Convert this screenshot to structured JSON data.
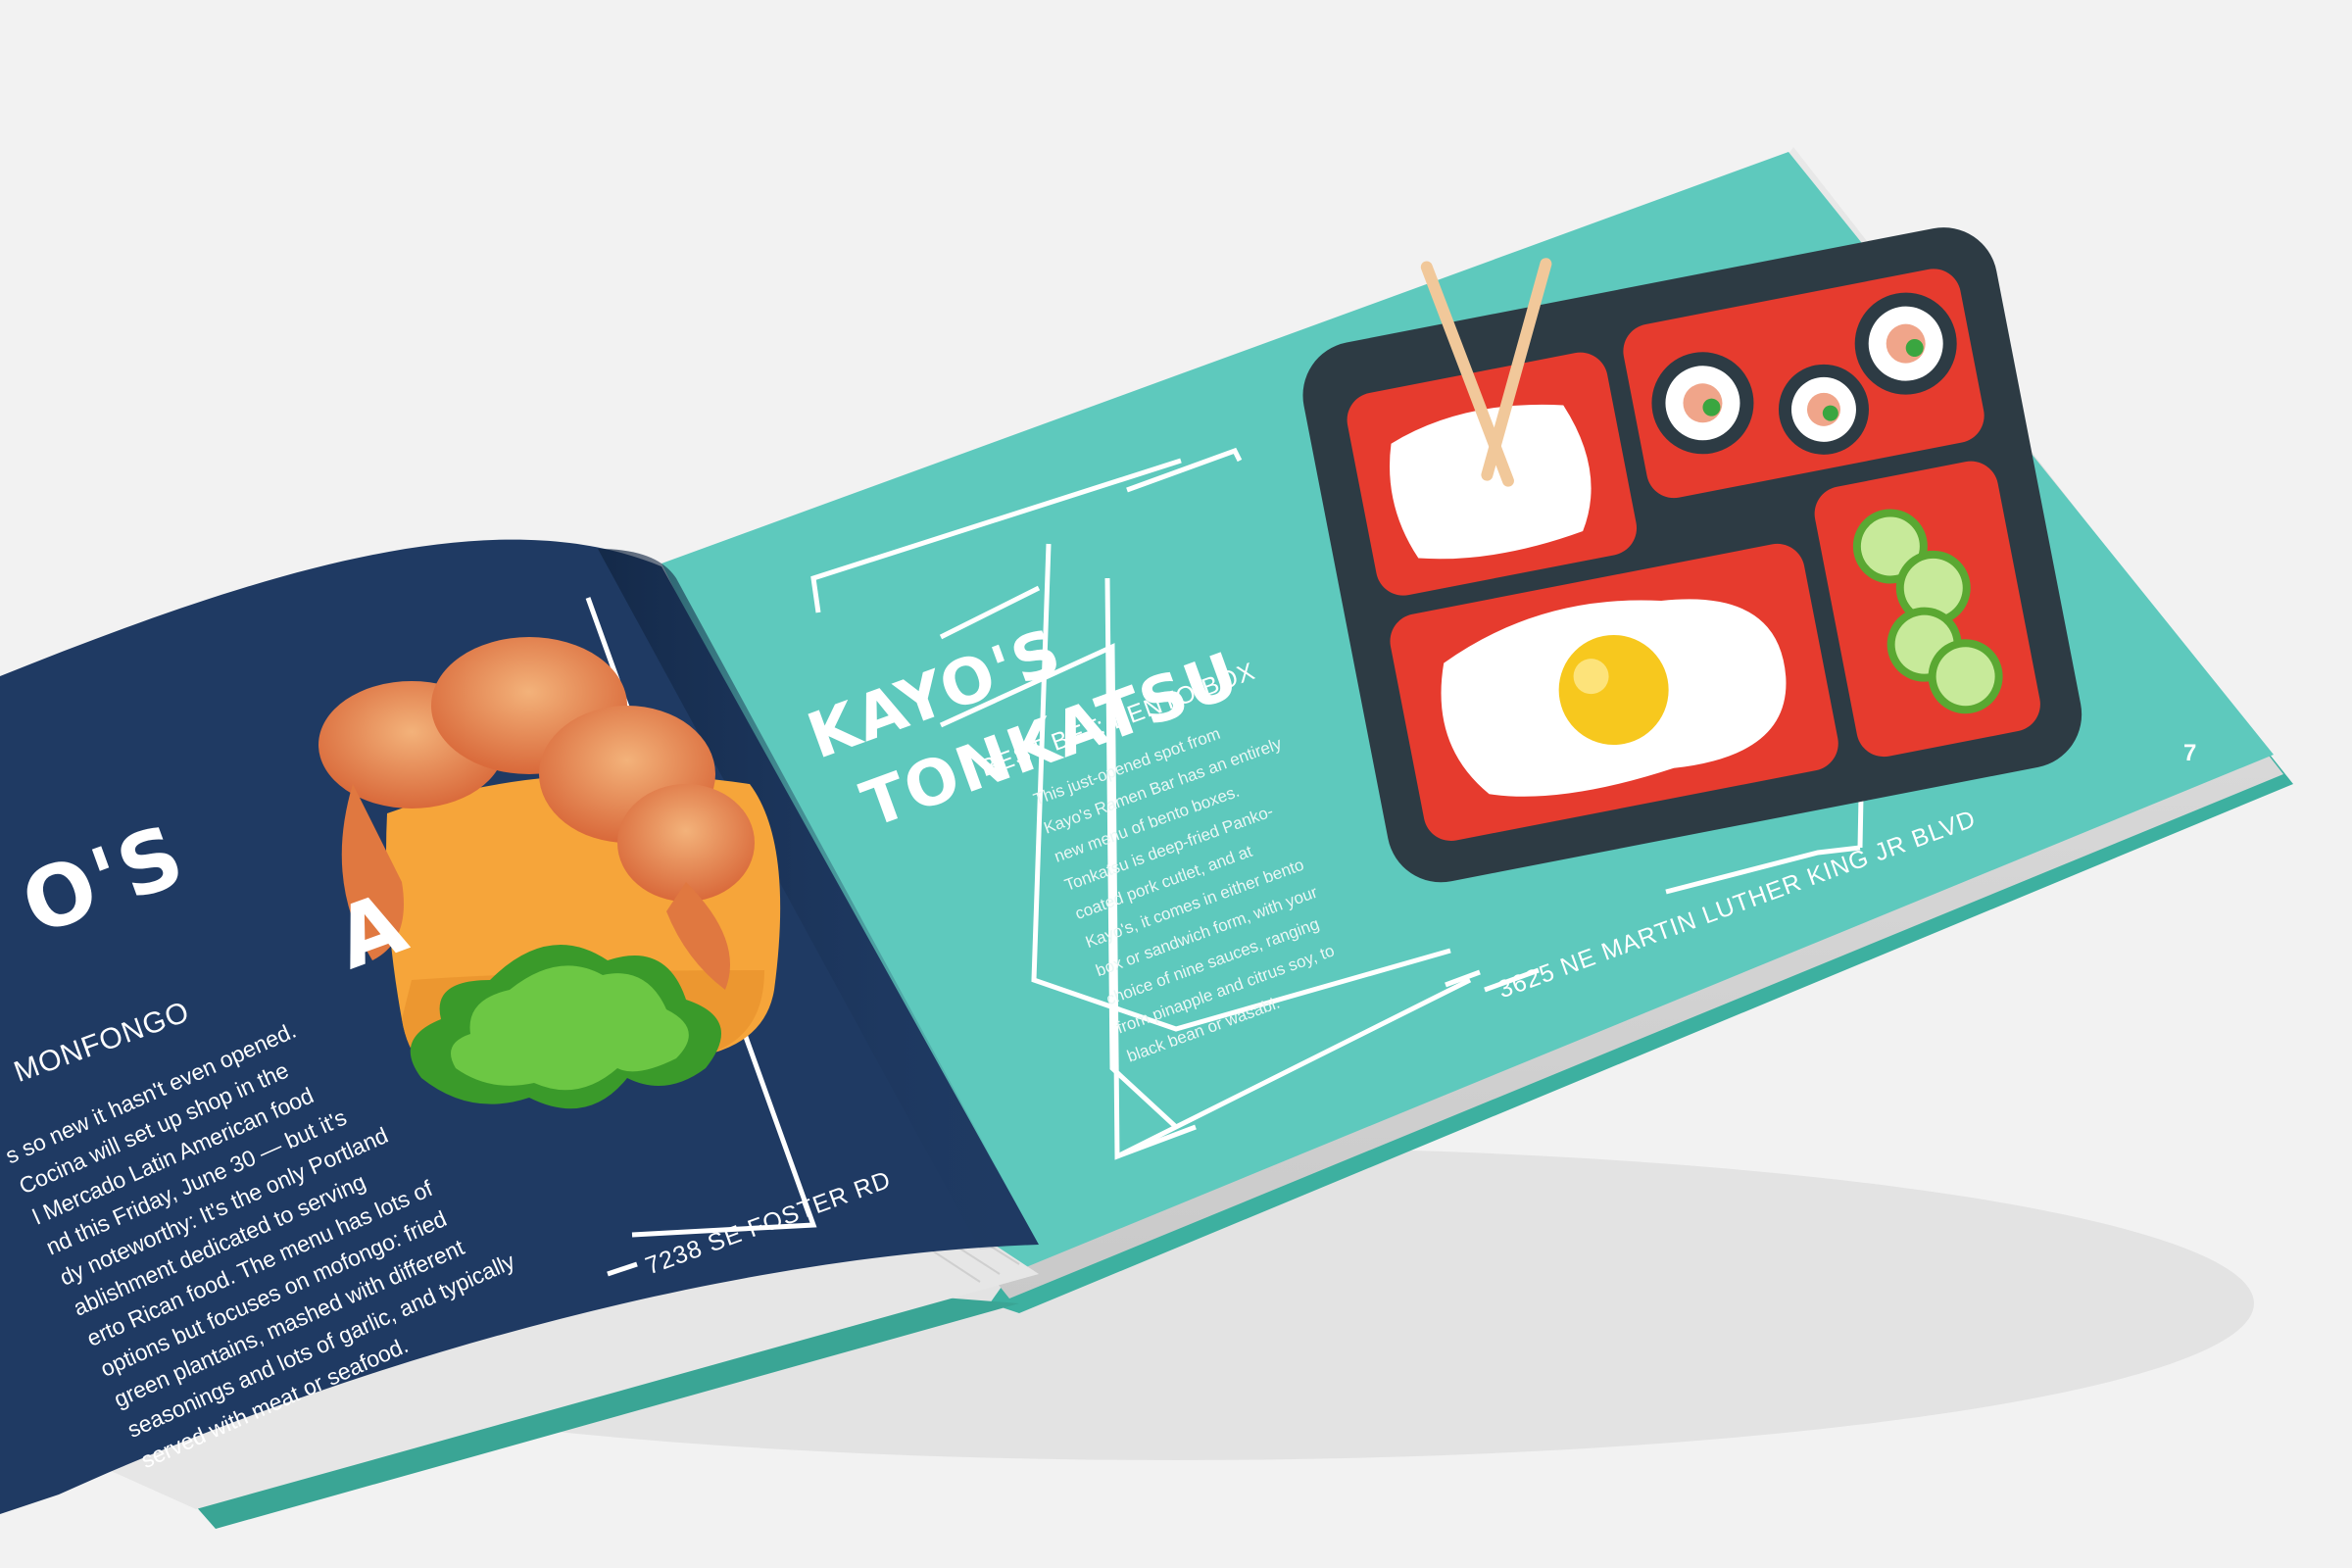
{
  "right_page": {
    "title_line1": "KAYO'S",
    "title_line2": "TONKATSU",
    "best_bet": "BEST BET:  BENTO BOX",
    "body_lines": [
      "This just-opened spot from",
      "Kayo's Ramen Bar has an entirely",
      "new menu of bento boxes.",
      "Tonkatsu is deep-fried Panko-",
      "coated pork cutlet, and at",
      "Kayo's, it comes in either bento",
      "box or sandwich form, with your",
      "choice of nine sauces, ranging",
      "from pinapple and citrus soy, to",
      "black bean or wasabi."
    ],
    "address": "3625 NE MARTIN LUTHER KING JR BLVD",
    "page_number": "7"
  },
  "left_page": {
    "title_fragment1": "O'S",
    "title_fragment2": "A",
    "best_bet_fragment": "MONFONGO",
    "body_lines": [
      "s so new it hasn't even opened.",
      "Cocina will set up shop in the",
      "l Mercado Latin American food",
      "nd this Friday, June 30 — but it's",
      "dy noteworthy: It's the only Portland",
      "ablishment dedicated to serving",
      "erto Rican food. The menu has lots of",
      "options but focuses on mofongo: fried",
      "green plantains, mashed with different",
      "seasonings and lots of garlic, and typically",
      "served with meat or seafood."
    ],
    "address": "7238 SE FOSTER RD"
  },
  "colors": {
    "background": "#f2f2f2",
    "teal_page": "#5ec9bd",
    "navy_page": "#1f3a63",
    "bento_tray": "#2d3b44",
    "bento_red": "#e63b2e",
    "egg_yolk": "#f7c81e"
  }
}
